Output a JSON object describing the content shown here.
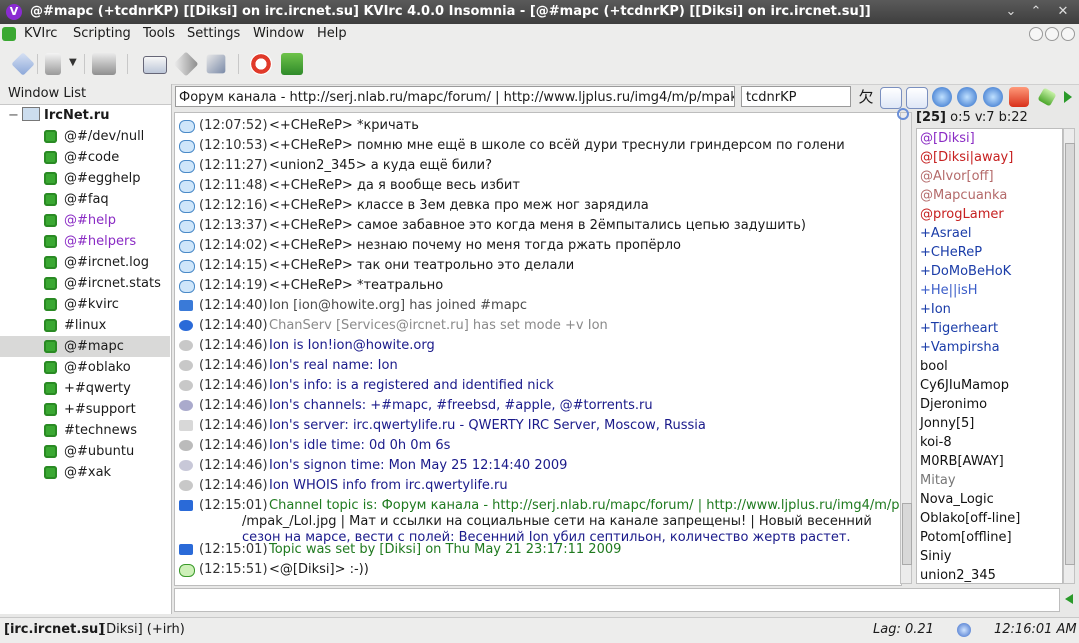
{
  "titlebar": {
    "title": "@#mapc (+tcdnrKP) [[Diksi] on irc.ircnet.su] KVIrc 4.0.0 Insomnia - [@#mapc (+tcdnrKP) [[Diksi] on irc.ircnet.su]]",
    "app_badge": "V",
    "min_glyph": "⌄",
    "max_glyph": "⌃",
    "close_glyph": "✕"
  },
  "menubar": {
    "items": [
      "KVIrc",
      "Scripting",
      "Tools",
      "Settings",
      "Window",
      "Help"
    ]
  },
  "window_list": {
    "header": "Window List",
    "network": "IrcNet.ru",
    "expand_glyph": "−",
    "channels": [
      {
        "name": "@#/dev/null",
        "magenta": false,
        "selected": false
      },
      {
        "name": "@#code",
        "magenta": false,
        "selected": false
      },
      {
        "name": "@#egghelp",
        "magenta": false,
        "selected": false
      },
      {
        "name": "@#faq",
        "magenta": false,
        "selected": false
      },
      {
        "name": "@#help",
        "magenta": true,
        "selected": false
      },
      {
        "name": "@#helpers",
        "magenta": true,
        "selected": false
      },
      {
        "name": "@#ircnet.log",
        "magenta": false,
        "selected": false
      },
      {
        "name": "@#ircnet.stats",
        "magenta": false,
        "selected": false
      },
      {
        "name": "@#kvirc",
        "magenta": false,
        "selected": false
      },
      {
        "name": "#linux",
        "magenta": false,
        "selected": false
      },
      {
        "name": "@#mapc",
        "magenta": false,
        "selected": true
      },
      {
        "name": "@#oblako",
        "magenta": false,
        "selected": false
      },
      {
        "name": "+#qwerty",
        "magenta": false,
        "selected": false
      },
      {
        "name": "+#support",
        "magenta": false,
        "selected": false
      },
      {
        "name": "#technews",
        "magenta": false,
        "selected": false
      },
      {
        "name": "@#ubuntu",
        "magenta": false,
        "selected": false
      },
      {
        "name": "@#xak",
        "magenta": false,
        "selected": false
      }
    ]
  },
  "channel": {
    "topic": "Форум канала - http://serj.nlab.ru/mapc/forum/ | http://www.ljplus.ru/img4/m/p/mpak",
    "mode": "tcdnrKP"
  },
  "chat": {
    "lines": [
      {
        "icon": "speech-bubble-icon",
        "time": "(12:07:52)",
        "text": "<+CHeReP> *кричать"
      },
      {
        "icon": "speech-bubble-icon",
        "time": "(12:10:53)",
        "text": "<+CHeReP> помню мне ещё в школе со всёй дури треснули гриндерсом по голени"
      },
      {
        "icon": "speech-bubble-icon",
        "time": "(12:11:27)",
        "text": "<union2_345> а куда ещё били?"
      },
      {
        "icon": "speech-bubble-icon",
        "time": "(12:11:48)",
        "text": "<+CHeReP> да я вообще весь избит"
      },
      {
        "icon": "speech-bubble-icon",
        "time": "(12:12:16)",
        "text": "<+CHeReP> классе в 3ем девка про меж ног зарядила"
      },
      {
        "icon": "speech-bubble-icon",
        "time": "(12:13:37)",
        "text": "<+CHeReP> самое забавное это когда меня в 2ёмпытались цепью задушить)"
      },
      {
        "icon": "speech-bubble-icon",
        "time": "(12:14:02)",
        "text": "<+CHeReP> незнаю почему но меня тогда ржать пропёрло"
      },
      {
        "icon": "speech-bubble-icon",
        "time": "(12:14:15)",
        "text": "<+CHeReP> так они театрольно это делали"
      },
      {
        "icon": "speech-bubble-icon",
        "time": "(12:14:19)",
        "text": "<+CHeReP> *театрально"
      },
      {
        "icon": "join-arrow-icon",
        "time": "(12:14:40)",
        "text": "Ion [ion@howite.org] has joined #mapc"
      },
      {
        "icon": "mode-plus-icon",
        "time": "(12:14:40)",
        "text": "ChanServ [Services@ircnet.ru] has set mode +v Ion"
      },
      {
        "icon": "whois-head-icon",
        "time": "(12:14:46)",
        "text": "Ion is Ion!ion@howite.org"
      },
      {
        "icon": "whois-head-icon",
        "time": "(12:14:46)",
        "text": "Ion's real name: Ion"
      },
      {
        "icon": "whois-head-icon",
        "time": "(12:14:46)",
        "text": "Ion's info: is a registered and identified nick"
      },
      {
        "icon": "whois-group-icon",
        "time": "(12:14:46)",
        "text": "Ion's channels: +#mapc, #freebsd, #apple, @#torrents.ru"
      },
      {
        "icon": "whois-server-icon",
        "time": "(12:14:46)",
        "text": "Ion's server: irc.qwertylife.ru - QWERTY IRC Server, Moscow, Russia"
      },
      {
        "icon": "whois-idle-icon",
        "time": "(12:14:46)",
        "text": "Ion's idle time: 0d 0h 0m 6s"
      },
      {
        "icon": "whois-signon-icon",
        "time": "(12:14:46)",
        "text": "Ion's signon time: Mon May 25 12:14:40 2009"
      },
      {
        "icon": "whois-head-icon",
        "time": "(12:14:46)",
        "text": "Ion WHOIS info from irc.qwertylife.ru"
      },
      {
        "icon": "topic-t-icon",
        "time": "(12:15:01)",
        "text": "Channel topic is: Форум канала - http://serj.nlab.ru/mapc/forum/ | http://www.ljplus.ru/img4/m/p"
      },
      {
        "icon": "",
        "time": "",
        "text": "/mpak_/Lol.jpg | Мат и ссылки на социальные сети на канале запрещены! | Новый весенний"
      },
      {
        "icon": "",
        "time": "",
        "text": "сезон на марсе, вести с полей: Весенний Ion убил септильон, количество жертв растет."
      },
      {
        "icon": "topic-t-icon",
        "time": "(12:15:01)",
        "text": "Topic was set by [Diksi] on Thu May 21 23:17:11 2009"
      },
      {
        "icon": "speech-bubble-green-icon",
        "time": "(12:15:51)",
        "text": "<@[Diksi]> :-))"
      }
    ]
  },
  "userlist": {
    "stats": "[25] o:5 v:7 b:22",
    "users": [
      {
        "name": "@[Diksi]",
        "color": "#8a2bc4"
      },
      {
        "name": "@[Diksi|away]",
        "color": "#c62020"
      },
      {
        "name": "@Alvor[off]",
        "color": "#b46a6a"
      },
      {
        "name": "@Mapcuanka",
        "color": "#b46a6a"
      },
      {
        "name": "@progLamer",
        "color": "#c62020"
      },
      {
        "name": "+Asrael",
        "color": "#1a3ca8"
      },
      {
        "name": "+CHeReP",
        "color": "#1a3ca8"
      },
      {
        "name": "+DoMoBeHoK",
        "color": "#1a3ca8"
      },
      {
        "name": "+He||isH",
        "color": "#3a5cc8"
      },
      {
        "name": "+Ion",
        "color": "#1a3ca8"
      },
      {
        "name": "+Tigerheart",
        "color": "#1a3ca8"
      },
      {
        "name": "+Vampirsha",
        "color": "#1a3ca8"
      },
      {
        "name": "bool",
        "color": "#111111"
      },
      {
        "name": "Cy6JIuMamop",
        "color": "#111111"
      },
      {
        "name": "Djeronimo",
        "color": "#111111"
      },
      {
        "name": "Jonny[5]",
        "color": "#111111"
      },
      {
        "name": "koi-8",
        "color": "#111111"
      },
      {
        "name": "M0RB[AWAY]",
        "color": "#111111"
      },
      {
        "name": "Mitay",
        "color": "#777777"
      },
      {
        "name": "Nova_Logic",
        "color": "#111111"
      },
      {
        "name": "Oblako[off-line]",
        "color": "#111111"
      },
      {
        "name": "Potom[offline]",
        "color": "#111111"
      },
      {
        "name": "Siniy",
        "color": "#111111"
      },
      {
        "name": "union2_345",
        "color": "#111111"
      }
    ]
  },
  "statusbar": {
    "server": "[irc.ircnet.su]",
    "nick": "[Diksi] (+irh)",
    "lag": "Lag: 0.21",
    "clock": "12:16:01 AM"
  },
  "colors": {
    "accent": "#3aa832",
    "nick_blue": "#1a3ca8",
    "topic_green": "#1f7a1f",
    "whois_navy": "#1a1a8a"
  }
}
